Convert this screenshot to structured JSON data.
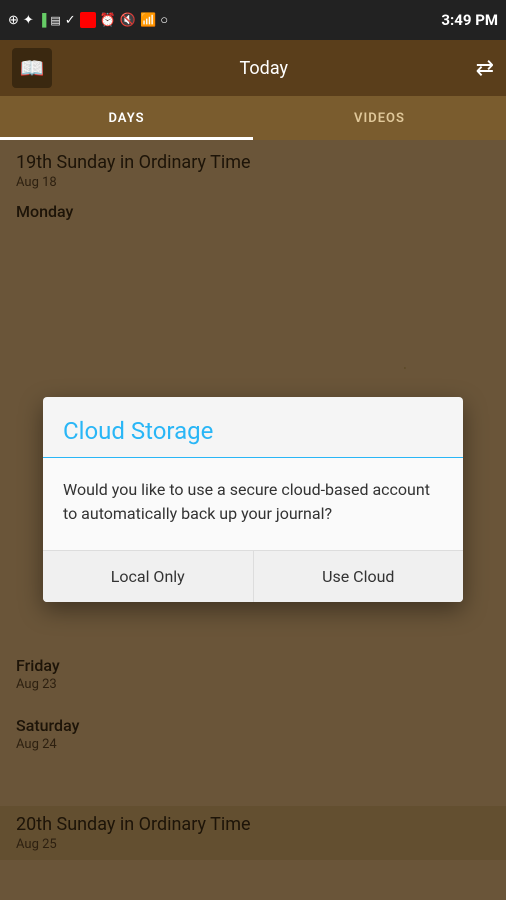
{
  "statusBar": {
    "time": "3:49 PM",
    "icons": [
      "usb",
      "battery",
      "sim",
      "checkbox",
      "cross",
      "clock",
      "sound-off",
      "wifi",
      "circle",
      "battery-full"
    ]
  },
  "topBar": {
    "title": "Today",
    "appIcon": "📖",
    "filterIcon": "⇌"
  },
  "tabs": [
    {
      "label": "DAYS",
      "active": true
    },
    {
      "label": "VIDEOS",
      "active": false
    }
  ],
  "content": {
    "sections": [
      {
        "title": "19th Sunday in Ordinary Time",
        "date": "Aug 18"
      },
      {
        "dayLabel": "Monday"
      },
      {
        "dayLabel": "Friday",
        "date": "Aug 23"
      },
      {
        "dayLabel": "Saturday",
        "date": "Aug 24"
      },
      {
        "title": "20th Sunday in Ordinary Time",
        "date": "Aug 25"
      }
    ]
  },
  "dialog": {
    "title": "Cloud Storage",
    "message": "Would you like to use a secure cloud-based account to automatically back up your journal?",
    "buttons": [
      {
        "label": "Local Only",
        "action": "local"
      },
      {
        "label": "Use Cloud",
        "action": "cloud"
      }
    ]
  }
}
